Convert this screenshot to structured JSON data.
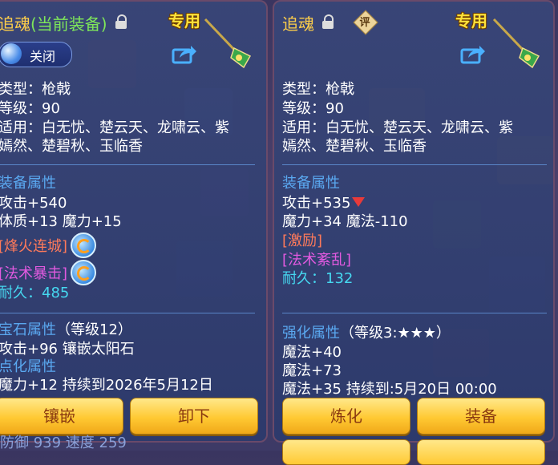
{
  "left": {
    "title_name": "追魂",
    "title_current": "(当前装备)",
    "exclusive": "专用",
    "toggle_label": "关闭",
    "type": "类型：枪戟",
    "level": "等级：90",
    "suitable_1": "适用：白无忧、楚云天、龙啸云、紫",
    "suitable_2": "嫣然、楚碧秋、玉临香",
    "equip_attr": "装备属性",
    "attack": "攻击+540",
    "stats": "体质+13 魔力+15",
    "skill1": "[烽火连城]",
    "skill2": "[法术暴击]",
    "durability_label": "耐久：",
    "durability_value": "485",
    "gem_attr": "宝石属性",
    "gem_level": "（等级12）",
    "gem_line": "攻击+96 镶嵌太阳石",
    "enchant_attr": "点化属性",
    "enchant_line": "魔力+12 持续到2026年5月12日",
    "btn_inlay": "镶嵌",
    "btn_unequip": "卸下",
    "bottom_text": "防御    939        速度    259"
  },
  "right": {
    "title_name": "追魂",
    "eval_badge": "评",
    "exclusive": "专用",
    "type": "类型：枪戟",
    "level": "等级：90",
    "suitable_1": "适用：白无忧、楚云天、龙啸云、紫",
    "suitable_2": "嫣然、楚碧秋、玉临香",
    "equip_attr": "装备属性",
    "attack": "攻击+535",
    "stats": "魔力+34 魔法-110",
    "skill1": "[激励]",
    "skill2": "[法术紊乱]",
    "durability_label": "耐久：",
    "durability_value": "132",
    "strengthen_attr": "强化属性",
    "strengthen_level": "（等级3:★★★）",
    "str1": "魔法+40",
    "str2": "魔法+73",
    "str3": "魔法+35     持续到:5月20日 00:00",
    "btn_refine": "炼化",
    "btn_equip": "装备"
  },
  "colors": {
    "section_blue": "#5aa8f0",
    "skill_orange": "#ff7a5a",
    "skill_pink": "#e25ae0",
    "durability_cyan": "#46d8f0",
    "title_gold": "#ffcf4a",
    "current_green": "#7ee65a"
  }
}
